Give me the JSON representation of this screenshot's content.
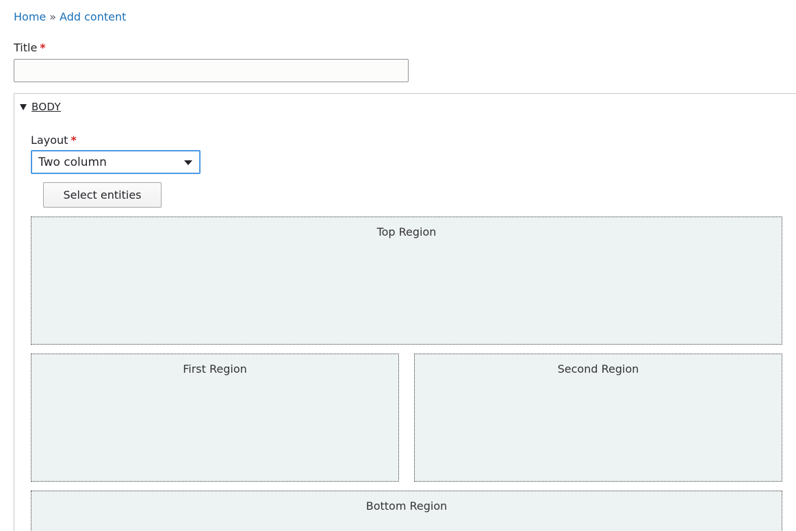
{
  "breadcrumb": {
    "home": "Home",
    "separator": "»",
    "current": "Add content"
  },
  "form": {
    "title_label": "Title",
    "required_marker": "*",
    "title_value": "",
    "body_summary": "BODY",
    "layout_label": "Layout",
    "layout_value": "Two column",
    "select_entities_label": "Select entities"
  },
  "regions": {
    "top": "Top Region",
    "first": "First Region",
    "second": "Second Region",
    "bottom": "Bottom Region"
  },
  "colors": {
    "link": "#1a70b8",
    "required": "#d72222",
    "focus_border": "#4b9ae4",
    "region_background": "#edf2f2"
  },
  "icons": {
    "collapse": "triangle-down-icon",
    "select_caret": "caret-down-icon"
  }
}
